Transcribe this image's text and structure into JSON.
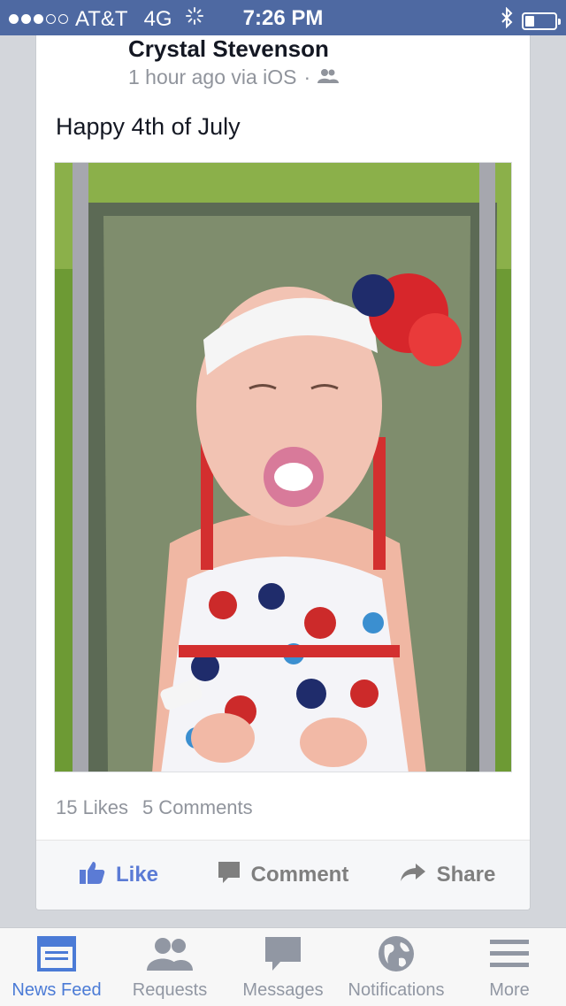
{
  "status_bar": {
    "carrier": "AT&T",
    "network": "4G",
    "time": "7:26 PM",
    "signal_bars_filled": 3,
    "signal_bars_total": 5,
    "battery_level": 0.3
  },
  "post": {
    "author": "Crystal Stevenson",
    "timestamp": "1 hour ago via iOS",
    "separator": "·",
    "audience_icon": "friends-icon",
    "text": "Happy 4th of July",
    "photo_icon": "photo",
    "likes": "15 Likes",
    "comments": "5 Comments"
  },
  "actions": {
    "like": "Like",
    "comment": "Comment",
    "share": "Share"
  },
  "tabbar": {
    "items": [
      {
        "label": "News Feed",
        "icon": "news-feed-icon"
      },
      {
        "label": "Requests",
        "icon": "friends-icon"
      },
      {
        "label": "Messages",
        "icon": "messages-icon"
      },
      {
        "label": "Notifications",
        "icon": "globe-icon"
      },
      {
        "label": "More",
        "icon": "menu-icon"
      }
    ],
    "active": "News Feed"
  },
  "colors": {
    "status_bar": "#4e69a2",
    "accent": "#4b7bd6",
    "muted": "#90949c"
  }
}
